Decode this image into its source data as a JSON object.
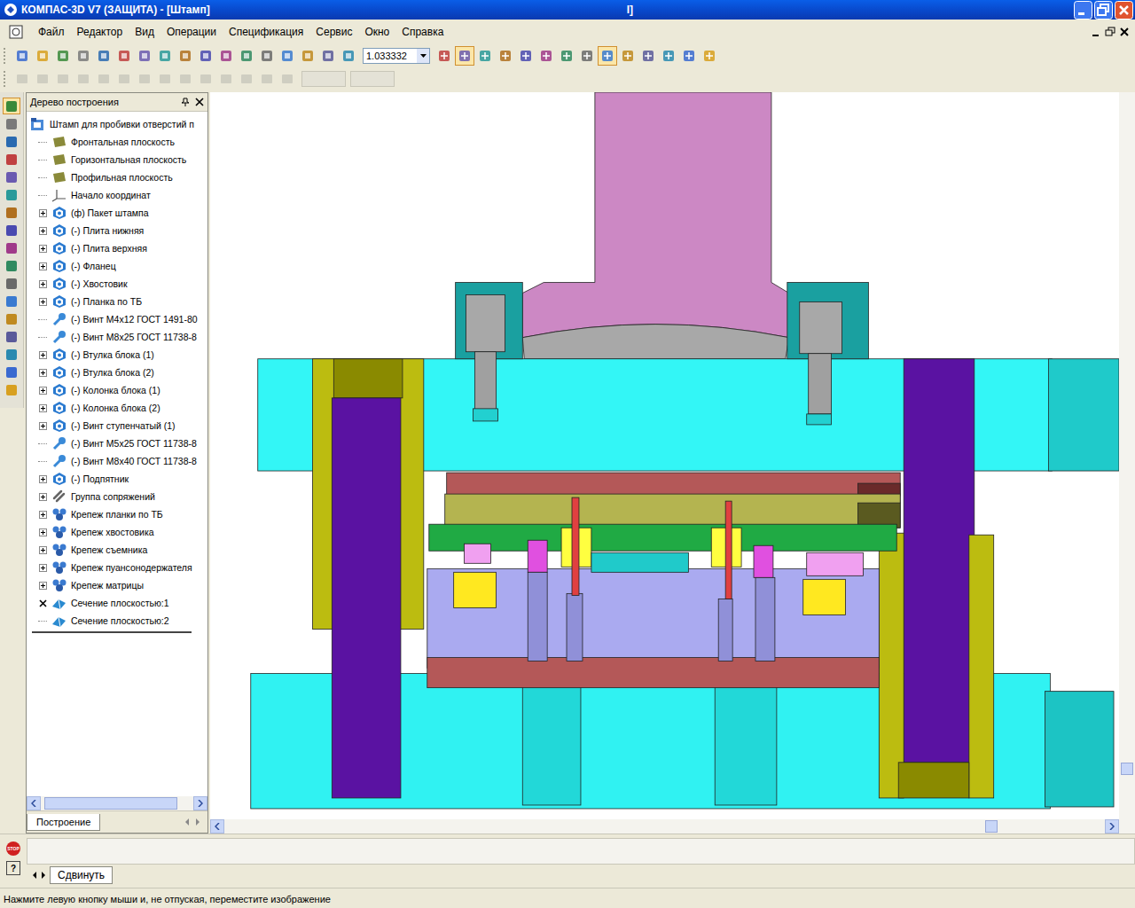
{
  "window": {
    "title": "КОМПАС-3D V7 (ЗАЩИТА) - [Штамп]",
    "title_fragment": "I]"
  },
  "menu": {
    "items": [
      "Файл",
      "Редактор",
      "Вид",
      "Операции",
      "Спецификация",
      "Сервис",
      "Окно",
      "Справка"
    ]
  },
  "toolbar": {
    "zoom": "1.033332",
    "tools_before": [
      {
        "selected": false
      },
      {
        "selected": false
      },
      {
        "selected": false
      },
      {
        "selected": false
      },
      {
        "selected": false
      },
      {
        "selected": false
      },
      {
        "selected": false
      },
      {
        "selected": false
      },
      {
        "selected": false
      },
      {
        "selected": false
      },
      {
        "selected": false
      },
      {
        "selected": false
      },
      {
        "selected": false
      },
      {
        "selected": false
      },
      {
        "selected": false
      },
      {
        "selected": false
      },
      {
        "selected": false
      }
    ],
    "tools_after": [
      {
        "selected": false
      },
      {
        "selected": true
      },
      {
        "selected": false
      },
      {
        "selected": false
      },
      {
        "selected": false
      },
      {
        "selected": false
      },
      {
        "selected": false
      },
      {
        "selected": false
      },
      {
        "selected": true
      },
      {
        "selected": false
      },
      {
        "selected": false
      },
      {
        "selected": false
      },
      {
        "selected": false
      },
      {
        "selected": false
      }
    ]
  },
  "secondary_toolbar": {
    "disabled": true
  },
  "left_tools": [
    {
      "selected": true
    },
    {
      "selected": false
    },
    {
      "selected": false
    },
    {
      "selected": false
    },
    {
      "selected": false
    },
    {
      "selected": false
    },
    {
      "selected": false
    },
    {
      "selected": false
    },
    {
      "selected": false
    },
    {
      "selected": false
    },
    {
      "selected": false
    },
    {
      "selected": false
    },
    {
      "selected": false
    },
    {
      "selected": false
    },
    {
      "selected": false
    },
    {
      "selected": false
    },
    {
      "selected": false
    }
  ],
  "tree": {
    "title": "Дерево построения",
    "tab": "Построение",
    "items": [
      {
        "label": "Штамп для пробивки отверстий п",
        "level": 0,
        "kind": "assembly",
        "expandable": false,
        "expanded": true,
        "excluded": false
      },
      {
        "label": "Фронтальная плоскость",
        "level": 1,
        "kind": "plane",
        "expandable": false,
        "expanded": false,
        "excluded": false
      },
      {
        "label": "Горизонтальная плоскость",
        "level": 1,
        "kind": "plane",
        "expandable": false,
        "expanded": false,
        "excluded": false
      },
      {
        "label": "Профильная плоскость",
        "level": 1,
        "kind": "plane",
        "expandable": false,
        "expanded": false,
        "excluded": false
      },
      {
        "label": "Начало координат",
        "level": 1,
        "kind": "origin",
        "expandable": false,
        "expanded": false,
        "excluded": false
      },
      {
        "label": "(ф) Пакет штампа",
        "level": 1,
        "kind": "part",
        "expandable": true,
        "expanded": false,
        "excluded": false
      },
      {
        "label": "(-) Плита нижняя",
        "level": 1,
        "kind": "part",
        "expandable": true,
        "expanded": false,
        "excluded": false
      },
      {
        "label": "(-) Плита верхняя",
        "level": 1,
        "kind": "part",
        "expandable": true,
        "expanded": false,
        "excluded": false
      },
      {
        "label": "(-) Фланец",
        "level": 1,
        "kind": "part",
        "expandable": true,
        "expanded": false,
        "excluded": false
      },
      {
        "label": "(-) Хвостовик",
        "level": 1,
        "kind": "part",
        "expandable": true,
        "expanded": false,
        "excluded": false
      },
      {
        "label": "(-) Планка по ТБ",
        "level": 1,
        "kind": "part",
        "expandable": true,
        "expanded": false,
        "excluded": false
      },
      {
        "label": "(-) Винт М4х12 ГОСТ 1491-80",
        "level": 1,
        "kind": "standard",
        "expandable": false,
        "expanded": false,
        "excluded": false
      },
      {
        "label": "(-) Винт М8х25 ГОСТ 11738-8",
        "level": 1,
        "kind": "standard",
        "expandable": false,
        "expanded": false,
        "excluded": false
      },
      {
        "label": "(-) Втулка блока (1)",
        "level": 1,
        "kind": "part",
        "expandable": true,
        "expanded": false,
        "excluded": false
      },
      {
        "label": "(-) Втулка блока (2)",
        "level": 1,
        "kind": "part",
        "expandable": true,
        "expanded": false,
        "excluded": false
      },
      {
        "label": "(-) Колонка блока (1)",
        "level": 1,
        "kind": "part",
        "expandable": true,
        "expanded": false,
        "excluded": false
      },
      {
        "label": "(-) Колонка блока (2)",
        "level": 1,
        "kind": "part",
        "expandable": true,
        "expanded": false,
        "excluded": false
      },
      {
        "label": "(-) Винт ступенчатый (1)",
        "level": 1,
        "kind": "part",
        "expandable": true,
        "expanded": false,
        "excluded": false
      },
      {
        "label": "(-) Винт М5х25 ГОСТ 11738-8",
        "level": 1,
        "kind": "standard",
        "expandable": false,
        "expanded": false,
        "excluded": false
      },
      {
        "label": "(-) Винт М8х40 ГОСТ 11738-8",
        "level": 1,
        "kind": "standard",
        "expandable": false,
        "expanded": false,
        "excluded": false
      },
      {
        "label": "(-) Подпятник",
        "level": 1,
        "kind": "part",
        "expandable": true,
        "expanded": false,
        "excluded": false
      },
      {
        "label": "Группа сопряжений",
        "level": 1,
        "kind": "mate",
        "expandable": true,
        "expanded": false,
        "excluded": false
      },
      {
        "label": "Крепеж планки по ТБ",
        "level": 1,
        "kind": "array",
        "expandable": true,
        "expanded": false,
        "excluded": false
      },
      {
        "label": "Крепеж хвостовика",
        "level": 1,
        "kind": "array",
        "expandable": true,
        "expanded": false,
        "excluded": false
      },
      {
        "label": "Крепеж съемника",
        "level": 1,
        "kind": "array",
        "expandable": true,
        "expanded": false,
        "excluded": false
      },
      {
        "label": "Крепеж пуансонодержателя",
        "level": 1,
        "kind": "array",
        "expandable": true,
        "expanded": false,
        "excluded": false
      },
      {
        "label": "Крепеж матрицы",
        "level": 1,
        "kind": "array",
        "expandable": true,
        "expanded": false,
        "excluded": false
      },
      {
        "label": "Сечение плоскостью:1",
        "level": 1,
        "kind": "section",
        "expandable": false,
        "expanded": false,
        "excluded": true
      },
      {
        "label": "Сечение плоскостью:2",
        "level": 1,
        "kind": "section",
        "expandable": false,
        "expanded": false,
        "excluded": false
      }
    ]
  },
  "command_panel": {
    "stop_label": "STOP",
    "help_label": "?",
    "tab": "Сдвинуть"
  },
  "status_bar": {
    "text": "Нажмите левую кнопку мыши и, не отпуская, переместите изображение"
  }
}
